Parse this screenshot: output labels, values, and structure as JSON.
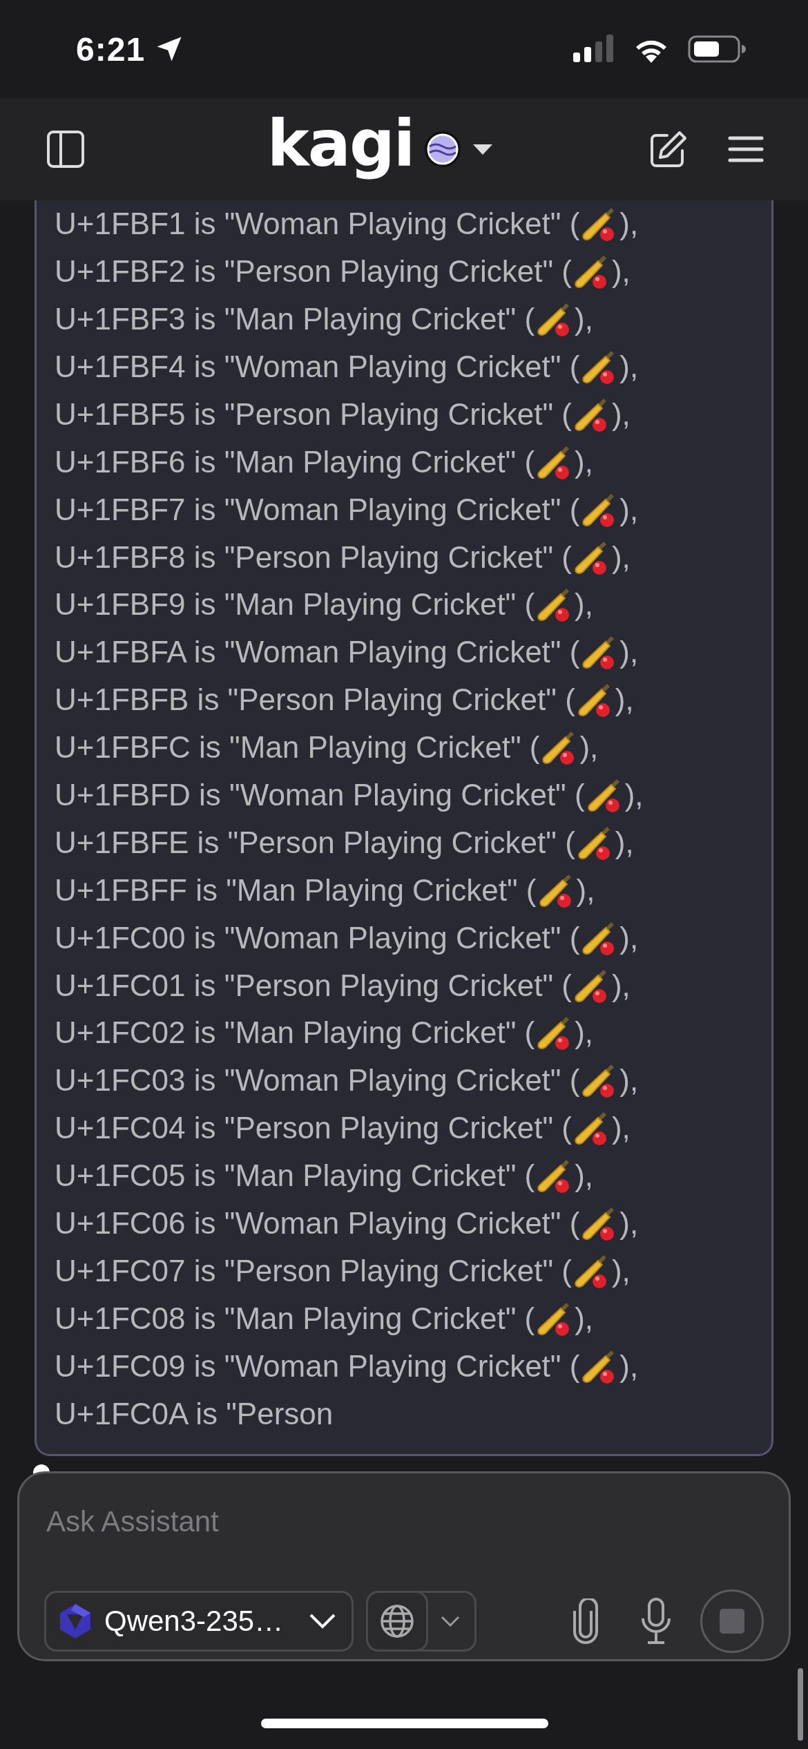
{
  "status_bar": {
    "time": "6:21"
  },
  "header": {
    "logo": "kagi"
  },
  "message": {
    "lines": [
      {
        "kind": "emoji",
        "text": "U+1FBF1 is \"Woman Playing Cricket\" (",
        "after": "),"
      },
      {
        "kind": "emoji",
        "text": "U+1FBF2 is \"Person Playing Cricket\" (",
        "after": "),"
      },
      {
        "kind": "emoji",
        "text": "U+1FBF3 is \"Man Playing Cricket\" (",
        "after": "),"
      },
      {
        "kind": "emoji",
        "text": "U+1FBF4 is \"Woman Playing Cricket\" (",
        "after": "),"
      },
      {
        "kind": "emoji",
        "text": "U+1FBF5 is \"Person Playing Cricket\" (",
        "after": "),"
      },
      {
        "kind": "emoji",
        "text": "U+1FBF6 is \"Man Playing Cricket\" (",
        "after": "),"
      },
      {
        "kind": "emoji",
        "text": "U+1FBF7 is \"Woman Playing Cricket\" (",
        "after": "),"
      },
      {
        "kind": "emoji",
        "text": "U+1FBF8 is \"Person Playing Cricket\" (",
        "after": "),"
      },
      {
        "kind": "emoji",
        "text": "U+1FBF9 is \"Man Playing Cricket\" (",
        "after": "),"
      },
      {
        "kind": "emoji",
        "text": "U+1FBFA is \"Woman Playing Cricket\" (",
        "after": "),"
      },
      {
        "kind": "emoji",
        "text": "U+1FBFB is \"Person Playing Cricket\" (",
        "after": "),"
      },
      {
        "kind": "emoji",
        "text": "U+1FBFC is \"Man Playing Cricket\" (",
        "after": "),"
      },
      {
        "kind": "emoji",
        "text": "U+1FBFD is \"Woman Playing Cricket\" (",
        "after": "),"
      },
      {
        "kind": "emoji",
        "text": "U+1FBFE is \"Person Playing Cricket\" (",
        "after": "),"
      },
      {
        "kind": "emoji",
        "text": "U+1FBFF is \"Man Playing Cricket\" (",
        "after": "),"
      },
      {
        "kind": "emoji",
        "text": "U+1FC00 is \"Woman Playing Cricket\" (",
        "after": "),"
      },
      {
        "kind": "emoji",
        "text": "U+1FC01 is \"Person Playing Cricket\" (",
        "after": "),"
      },
      {
        "kind": "emoji",
        "text": "U+1FC02 is \"Man Playing Cricket\" (",
        "after": "),"
      },
      {
        "kind": "emoji",
        "text": "U+1FC03 is \"Woman Playing Cricket\" (",
        "after": "),"
      },
      {
        "kind": "emoji",
        "text": "U+1FC04 is \"Person Playing Cricket\" (",
        "after": "),"
      },
      {
        "kind": "emoji",
        "text": "U+1FC05 is \"Man Playing Cricket\" (",
        "after": "),"
      },
      {
        "kind": "emoji",
        "text": "U+1FC06 is \"Woman Playing Cricket\" (",
        "after": "),"
      },
      {
        "kind": "emoji",
        "text": "U+1FC07 is \"Person Playing Cricket\" (",
        "after": "),"
      },
      {
        "kind": "emoji",
        "text": "U+1FC08 is \"Man Playing Cricket\" (",
        "after": "),"
      },
      {
        "kind": "emoji",
        "text": "U+1FC09 is \"Woman Playing Cricket\" (",
        "after": "),"
      },
      {
        "kind": "plain",
        "text": "U+1FC0A is \"Person"
      }
    ]
  },
  "composer": {
    "placeholder": "Ask Assistant",
    "model": "Qwen3-235…"
  }
}
